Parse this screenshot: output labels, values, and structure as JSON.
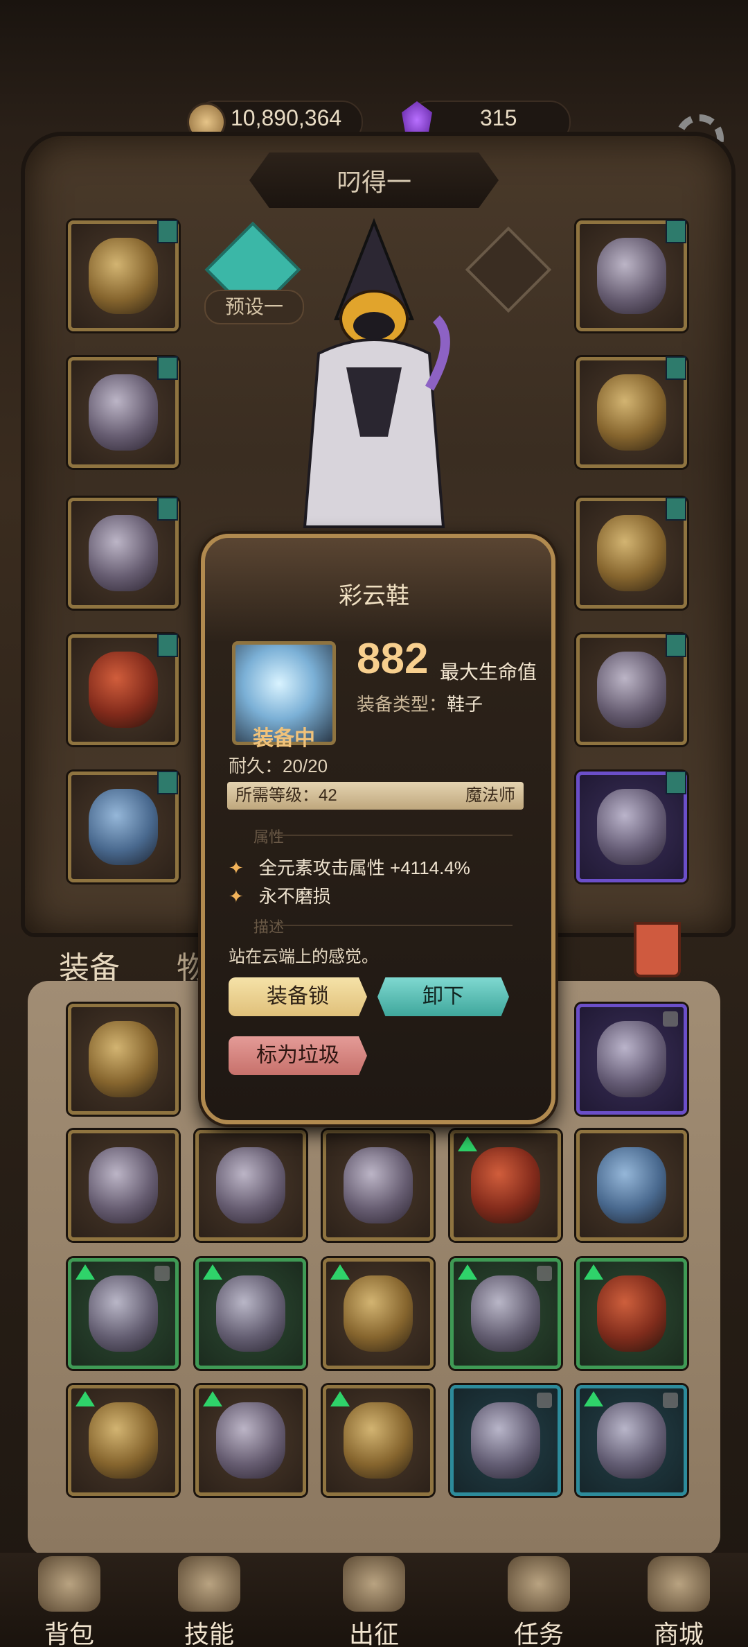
{
  "currency": {
    "gold": "10,890,364",
    "gems": "315"
  },
  "character": {
    "name": "叼得一"
  },
  "preset": {
    "label": "预设一"
  },
  "tabs": {
    "equipment": "装备",
    "items": "物"
  },
  "item_popup": {
    "name": "彩云鞋",
    "stat_value": "882",
    "stat_name": "最大生命值",
    "type_label": "装备类型：",
    "type_value": "鞋子",
    "equipped_label": "装备中",
    "durability": "耐久：20/20",
    "required_level": "所需等级：42",
    "class": "魔法师",
    "attributes_header": "属性",
    "attributes": [
      "全元素攻击属性 +4114.4%",
      "永不磨损"
    ],
    "description_header": "描述",
    "description": "站在云端上的感觉。",
    "buttons": {
      "lock": "装备锁",
      "unequip": "卸下",
      "mark_trash": "标为垃圾"
    }
  },
  "bottom_nav": [
    "背包",
    "技能",
    "出征",
    "任务",
    "商城"
  ]
}
